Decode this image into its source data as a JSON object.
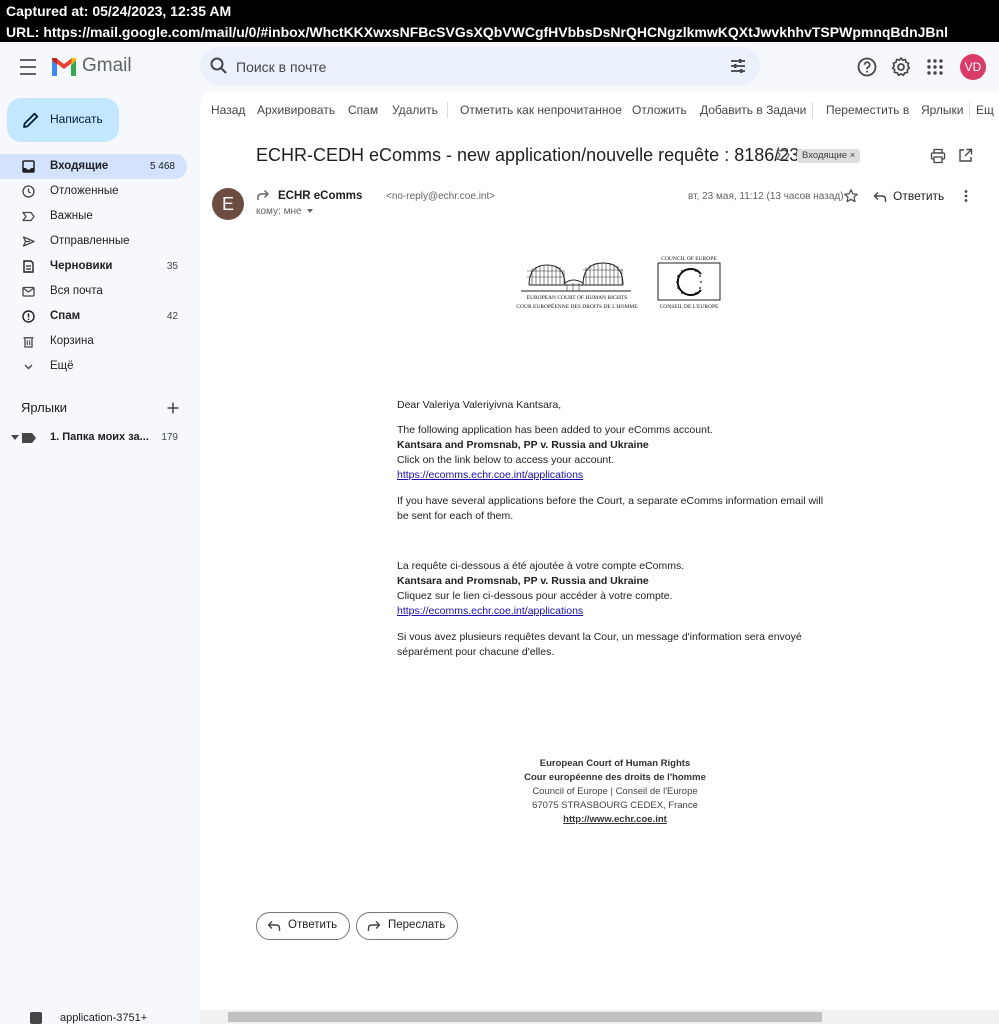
{
  "capture": {
    "captured_at": "Captured at: 05/24/2023, 12:35 AM",
    "url": "URL: https://mail.google.com/mail/u/0/#inbox/WhctKKXwxsNFBcSVGsXQbVWCgfHVbbsDsNrQHCNgzlkmwKQXtJwvkhhvTSPWpmnqBdnJBnl"
  },
  "header": {
    "app_name": "Gmail",
    "search_placeholder": "Поиск в почте",
    "avatar_initials": "VD"
  },
  "compose_label": "Написать",
  "nav": [
    {
      "label": "Входящие",
      "count": "5 468"
    },
    {
      "label": "Отложенные",
      "count": ""
    },
    {
      "label": "Важные",
      "count": ""
    },
    {
      "label": "Отправленные",
      "count": ""
    },
    {
      "label": "Черновики",
      "count": "35"
    },
    {
      "label": "Вся почта",
      "count": ""
    },
    {
      "label": "Спам",
      "count": "42"
    },
    {
      "label": "Корзина",
      "count": ""
    },
    {
      "label": "Ещё",
      "count": ""
    }
  ],
  "labels_section": {
    "title": "Ярлыки",
    "items": [
      {
        "label": "1. Папка моих за...",
        "count": "179"
      }
    ]
  },
  "attachment_peek": "application-3751+",
  "toolbar": {
    "back": "Назад",
    "archive": "Архивировать",
    "spam": "Спам",
    "delete": "Удалить",
    "mark_unread": "Отметить как непрочитанное",
    "snooze": "Отложить",
    "add_tasks": "Добавить в Задачи",
    "move_to": "Переместить в",
    "labels": "Ярлыки",
    "overflow": "Ещ"
  },
  "email": {
    "subject": "ECHR-CEDH eComms - new application/nouvelle requête : 8186/23",
    "inbox_chip": "Входящие",
    "sender_initial": "E",
    "sender_name": "ECHR eComms",
    "sender_email": "<no-reply@echr.coe.int>",
    "to": "кому: мне",
    "date": "вт, 23 мая, 11:12 (13 часов назад)",
    "reply_label": "Ответить",
    "logos": {
      "echr_line1": "EUROPEAN COURT OF HUMAN RIGHTS",
      "echr_line2": "COUR EUROPÉENNE DES DROITS DE L'HOMME",
      "coe_line1": "COUNCIL OF EUROPE",
      "coe_line2": "CONSEIL DE L'EUROPE"
    },
    "body": {
      "greeting": "Dear Valeriya Valeriyivna Kantsara,",
      "en_p1": "The following application has been added to your eComms account.",
      "case_name": "Kantsara and Promsnab, PP v. Russia and Ukraine",
      "en_p2": "Click on the link below to access your account.",
      "link": "https://ecomms.echr.coe.int/applications",
      "en_p3": "If you have several applications before the Court, a separate eComms information email will be sent for each of them.",
      "fr_p1": "La requête ci-dessous a été ajoutée à votre compte eComms.",
      "fr_case_name": "Kantsara and Promsnab, PP v. Russia and Ukraine",
      "fr_p2": "Cliquez sur le lien ci-dessous pour accéder à votre compte.",
      "fr_link": "https://ecomms.echr.coe.int/applications",
      "fr_p3": "Si vous avez plusieurs requêtes devant la Cour, un message d'information sera envoyé séparément pour chacune d'elles."
    },
    "footer": {
      "line1": "European Court of Human Rights",
      "line2": "Cour européenne des droits de l'homme",
      "line3": "Council of Europe | Conseil de l'Europe",
      "line4": "67075 STRASBOURG CEDEX, France",
      "link": "http://www.echr.coe.int"
    },
    "actions": {
      "reply": "Ответить",
      "forward": "Переслать"
    }
  },
  "colors": {
    "accent": "#0b57d0",
    "compose_bg": "#c2e7ff",
    "active_nav": "#d3e3fd",
    "avatar": "#d93c68"
  }
}
